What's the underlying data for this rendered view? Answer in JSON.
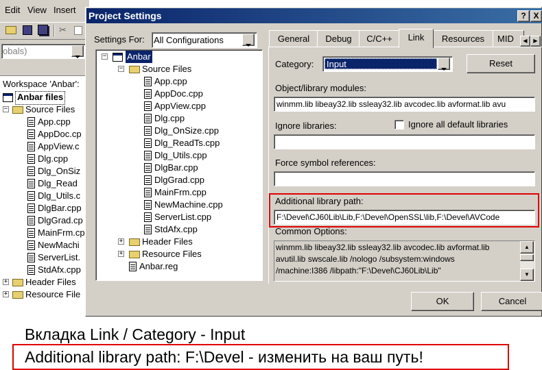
{
  "ide": {
    "menu": [
      "Edit",
      "View",
      "Insert"
    ],
    "combo_value": "obals)",
    "workspace_label": "Workspace 'Anbar':",
    "project_label": "Anbar files",
    "tree": [
      {
        "label": "Source Files",
        "kind": "folder"
      },
      {
        "label": "App.cpp",
        "kind": "file"
      },
      {
        "label": "AppDoc.cp",
        "kind": "file"
      },
      {
        "label": "AppView.c",
        "kind": "file"
      },
      {
        "label": "Dlg.cpp",
        "kind": "file"
      },
      {
        "label": "Dlg_OnSiz",
        "kind": "file"
      },
      {
        "label": "Dlg_Read",
        "kind": "file"
      },
      {
        "label": "Dlg_Utils.c",
        "kind": "file"
      },
      {
        "label": "DlgBar.cpp",
        "kind": "file"
      },
      {
        "label": "DlgGrad.cp",
        "kind": "file"
      },
      {
        "label": "MainFrm.cp",
        "kind": "file"
      },
      {
        "label": "NewMachi",
        "kind": "file"
      },
      {
        "label": "ServerList.",
        "kind": "file"
      },
      {
        "label": "StdAfx.cpp",
        "kind": "file"
      },
      {
        "label": "Header Files",
        "kind": "folder"
      },
      {
        "label": "Resource File",
        "kind": "folder"
      }
    ]
  },
  "dialog": {
    "title": "Project Settings",
    "help_button": "?",
    "close_button": "X",
    "settings_for_label": "Settings For:",
    "settings_for_value": "All Configurations",
    "tree": [
      {
        "label": "Anbar",
        "kind": "project"
      },
      {
        "label": "Source Files",
        "kind": "folder"
      },
      {
        "label": "App.cpp",
        "kind": "file"
      },
      {
        "label": "AppDoc.cpp",
        "kind": "file"
      },
      {
        "label": "AppView.cpp",
        "kind": "file"
      },
      {
        "label": "Dlg.cpp",
        "kind": "file"
      },
      {
        "label": "Dlg_OnSize.cpp",
        "kind": "file"
      },
      {
        "label": "Dlg_ReadTs.cpp",
        "kind": "file"
      },
      {
        "label": "Dlg_Utils.cpp",
        "kind": "file"
      },
      {
        "label": "DlgBar.cpp",
        "kind": "file"
      },
      {
        "label": "DlgGrad.cpp",
        "kind": "file"
      },
      {
        "label": "MainFrm.cpp",
        "kind": "file"
      },
      {
        "label": "NewMachine.cpp",
        "kind": "file"
      },
      {
        "label": "ServerList.cpp",
        "kind": "file"
      },
      {
        "label": "StdAfx.cpp",
        "kind": "file"
      },
      {
        "label": "Header Files",
        "kind": "folder"
      },
      {
        "label": "Resource Files",
        "kind": "folder"
      },
      {
        "label": "Anbar.reg",
        "kind": "file"
      }
    ],
    "tabs": [
      "General",
      "Debug",
      "C/C++",
      "Link",
      "Resources",
      "MID"
    ],
    "active_tab": "Link",
    "category_label": "Category:",
    "category_value": "Input",
    "reset_button": "Reset",
    "object_modules_label": "Object/library modules:",
    "object_modules_value": "winmm.lib libeay32.lib ssleay32.lib avcodec.lib avformat.lib avu",
    "ignore_libraries_label": "Ignore libraries:",
    "ignore_libraries_value": "",
    "ignore_all_label": "Ignore all default libraries",
    "force_symbol_label": "Force symbol references:",
    "force_symbol_value": "",
    "additional_path_label": "Additional library path:",
    "additional_path_value": "F:\\Devel\\CJ60Lib\\Lib,F:\\Devel\\OpenSSL\\lib,F:\\Devel\\AVCode",
    "common_options_label": "Common Options:",
    "common_options_lines": [
      "winmm.lib libeay32.lib ssleay32.lib avcodec.lib avformat.lib",
      "avutil.lib swscale.lib /nologo /subsystem:windows",
      "/machine:I386 /libpath:\"F:\\Devel\\CJ60Lib\\Lib\""
    ],
    "ok_button": "OK",
    "cancel_button": "Cancel"
  },
  "caption": {
    "line1": "Вкладка Link / Category - Input",
    "line2": "Additional library path: F:\\Devel - изменить на ваш путь!"
  },
  "colors": {
    "titlebar": "#0a246a",
    "dialog_bg": "#d4d0c8",
    "highlight": "#0a246a",
    "annotation_red": "#e00000"
  }
}
